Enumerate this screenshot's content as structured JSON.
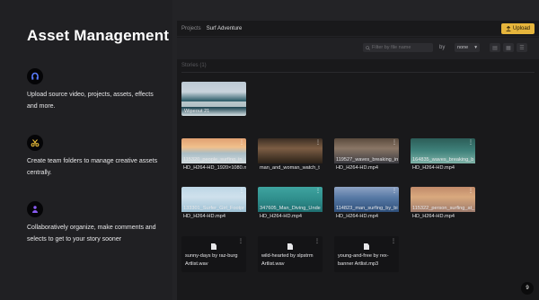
{
  "promo": {
    "title": "Asset Management",
    "features": [
      {
        "icon": "upload-icon",
        "text": "Upload source video, projects, assets, effects and more."
      },
      {
        "icon": "scissors-icon",
        "text": "Create team folders to manage creative assets centrally."
      },
      {
        "icon": "people-icon",
        "text": "Collaboratively organize, make comments and selects to get to your story sooner"
      }
    ]
  },
  "app": {
    "breadcrumb": {
      "root": "Projects",
      "current": "Surf Adventure"
    },
    "upload_label": "Upload",
    "search_placeholder": "Filter by file name",
    "sort_label": "by",
    "sort_value": "none",
    "section_label": "Stories (1)",
    "story": {
      "label": "Wipeout 21"
    },
    "videos": [
      {
        "line1": "115320_people_surfing_in",
        "line2": "HD_H264-HD_1920×1080.n"
      },
      {
        "line1": "man_and_woman_watch_t",
        "line2": ""
      },
      {
        "line1": "119527_waves_breaking_in",
        "line2": "HD_H264-HD.mp4"
      },
      {
        "line1": "164835_waves_breaking_b",
        "line2": "HD_H264-HD.mp4"
      },
      {
        "line1": "133301_Surfer_Girl_Footpr",
        "line2": "HD_H264-HD.mp4"
      },
      {
        "line1": "347605_Man_Diving_Unde",
        "line2": "HD_H264-HD.mp4"
      },
      {
        "line1": "114823_man_surfing_by_bi",
        "line2": "HD_H264-HD.mp4"
      },
      {
        "line1": "115322_person_surfing_at_",
        "line2": "HD_H264-HD.mp4"
      }
    ],
    "audio": [
      {
        "line1": "sunny-days by raz-burg",
        "line2": "Artlist.wav"
      },
      {
        "line1": "wild-hearted by slpstrm",
        "line2": "Artlist.wav"
      },
      {
        "line1": "young-and-free by rex-",
        "line2": "banner Artlist.mp3"
      }
    ],
    "more_glyph": "⋮",
    "corner_badge": "9"
  },
  "colors": {
    "accent": "#e6b53c",
    "background": "#232326"
  }
}
